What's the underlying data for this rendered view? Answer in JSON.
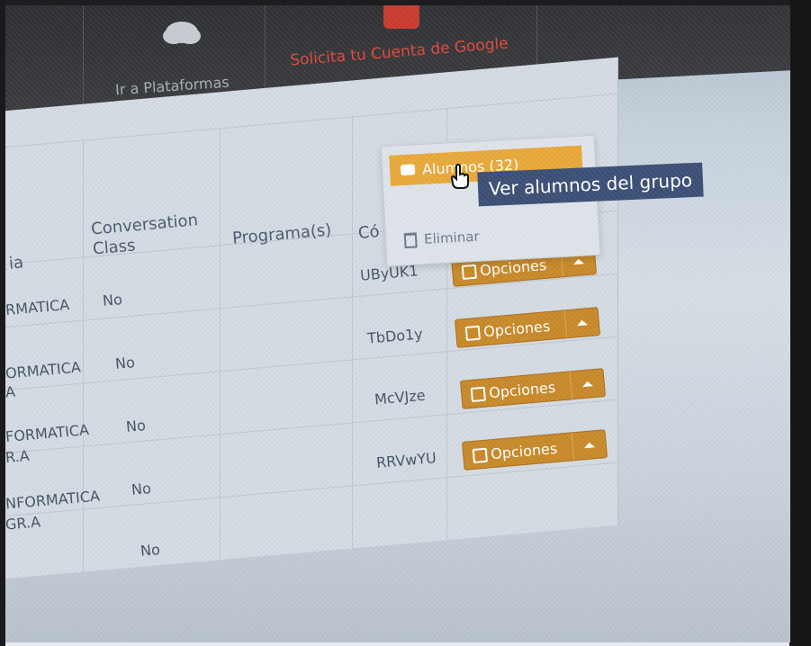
{
  "nav": {
    "platforms_label": "Ir a Plataformas",
    "google_label": "Solicita tu Cuenta de Google",
    "cloud_icon": "cloud-icon",
    "google_icon": "google-plus-icon",
    "accent_color": "#e0493c"
  },
  "table": {
    "headers": [
      "ia",
      "Conversation Class",
      "Programa(s)",
      "Có"
    ],
    "rows": [
      {
        "materia": "RMATICA",
        "materia2": "",
        "conversation": "No",
        "codigo": "UByUK1",
        "options_label": "Opciones"
      },
      {
        "materia": "ORMATICA",
        "materia2": "A",
        "conversation": "No",
        "codigo": "TbDo1y",
        "options_label": "Opciones"
      },
      {
        "materia": "FORMATICA",
        "materia2": "R.A",
        "conversation": "No",
        "codigo": "McVJze",
        "options_label": "Opciones"
      },
      {
        "materia": "NFORMATICA",
        "materia2": "GR.A",
        "conversation": "No",
        "codigo": "RRVwYU",
        "options_label": "Opciones"
      },
      {
        "materia": "",
        "materia2": "",
        "conversation": "No",
        "codigo": "",
        "options_label": ""
      }
    ]
  },
  "dropdown": {
    "alumnos_label": "Alumnos (32)",
    "eliminar_label": "Eliminar",
    "tooltip": "Ver alumnos del grupo"
  },
  "colors": {
    "button": "#c88a2a",
    "tooltip": "#3c5076",
    "header_bar": "#2e2f32"
  }
}
